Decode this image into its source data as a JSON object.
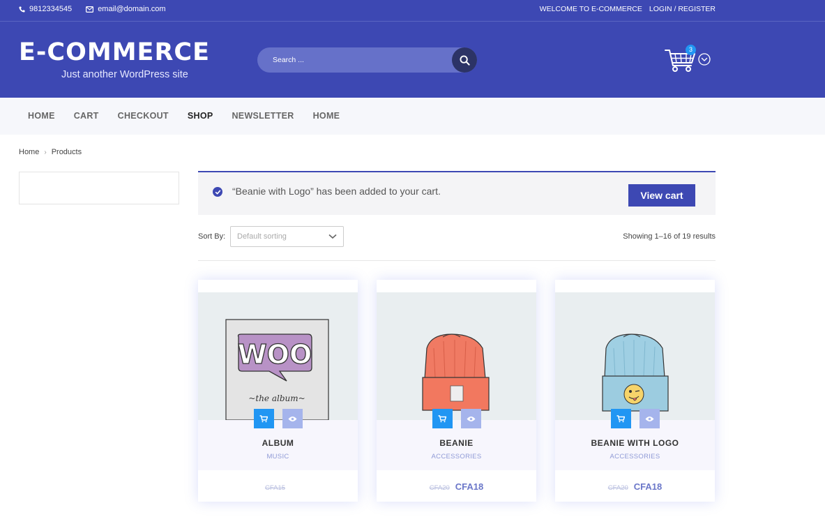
{
  "topbar": {
    "phone": "9812334545",
    "email": "email@domain.com",
    "welcome": "WELCOME TO E-COMMERCE",
    "login": "LOGIN / REGISTER"
  },
  "header": {
    "site_title": "E-COMMERCE",
    "tagline": "Just another WordPress site",
    "search_placeholder": "Search ...",
    "cart_count": "3"
  },
  "nav": {
    "items": [
      {
        "label": "HOME"
      },
      {
        "label": "CART"
      },
      {
        "label": "CHECKOUT"
      },
      {
        "label": "SHOP"
      },
      {
        "label": "NEWSLETTER"
      },
      {
        "label": "HOME"
      }
    ],
    "active": "SHOP"
  },
  "breadcrumb": {
    "home": "Home",
    "current": "Products"
  },
  "notice": {
    "message": "“Beanie with Logo” has been added to your cart.",
    "button": "View cart"
  },
  "toolbar": {
    "sort_label": "Sort By:",
    "sort_value": "Default sorting",
    "results": "Showing 1–16 of 19 results"
  },
  "products": [
    {
      "name": "ALBUM",
      "category": "MUSIC",
      "old_price": "CFA15",
      "price": ""
    },
    {
      "name": "BEANIE",
      "category": "ACCESSORIES",
      "old_price": "CFA20",
      "price": "CFA18"
    },
    {
      "name": "BEANIE WITH LOGO",
      "category": "ACCESSORIES",
      "old_price": "CFA20",
      "price": "CFA18"
    }
  ],
  "album_art": {
    "logo_text": "WOO",
    "subtitle": "~the  album~"
  },
  "colors": {
    "brand": "#3d48b3",
    "accent": "#2196f3"
  }
}
